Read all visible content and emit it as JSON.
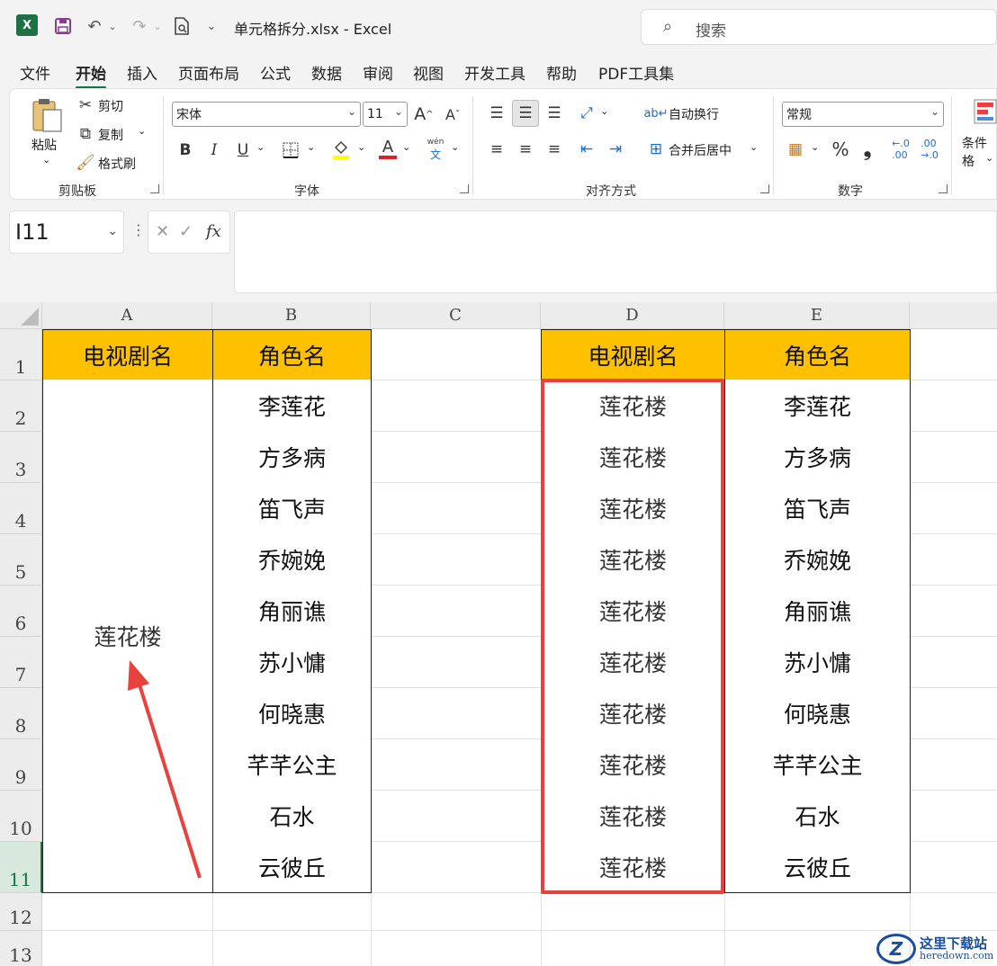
{
  "titlebar": {
    "app_icon": "X",
    "doc_title": "单元格拆分.xlsx  -  Excel",
    "search_placeholder": "搜索"
  },
  "menu": [
    "文件",
    "开始",
    "插入",
    "页面布局",
    "公式",
    "数据",
    "审阅",
    "视图",
    "开发工具",
    "帮助",
    "PDF工具集"
  ],
  "active_menu": "开始",
  "ribbon": {
    "clipboard": {
      "paste": "粘贴",
      "cut": "剪切",
      "copy": "复制",
      "format_painter": "格式刷",
      "label": "剪贴板"
    },
    "font": {
      "name": "宋体",
      "size": "11",
      "bold": "B",
      "italic": "I",
      "underline": "U",
      "font_color_glyph": "A",
      "phonetic": "wén",
      "label": "字体"
    },
    "align": {
      "wrap": "自动换行",
      "merge": "合并后居中",
      "label": "对齐方式"
    },
    "number": {
      "format": "常规",
      "percent": "%",
      "comma": "❟",
      "label": "数字"
    },
    "styles": {
      "cond_format": "条件格"
    }
  },
  "formula_bar": {
    "name_box": "I11",
    "fx": "fx",
    "value": ""
  },
  "columns": [
    "A",
    "B",
    "C",
    "D",
    "E"
  ],
  "rows": [
    "1",
    "2",
    "3",
    "4",
    "5",
    "6",
    "7",
    "8",
    "9",
    "10",
    "11",
    "12",
    "13"
  ],
  "selected_row": "11",
  "table_left": {
    "header_a": "电视剧名",
    "header_b": "角色名",
    "merged_value": "莲花楼",
    "roles": [
      "李莲花",
      "方多病",
      "笛飞声",
      "乔婉娩",
      "角丽谯",
      "苏小慵",
      "何晓惠",
      "芊芊公主",
      "石水",
      "云彼丘"
    ]
  },
  "table_right": {
    "header_d": "电视剧名",
    "header_e": "角色名",
    "drama": [
      "莲花楼",
      "莲花楼",
      "莲花楼",
      "莲花楼",
      "莲花楼",
      "莲花楼",
      "莲花楼",
      "莲花楼",
      "莲花楼",
      "莲花楼"
    ],
    "roles": [
      "李莲花",
      "方多病",
      "笛飞声",
      "乔婉娩",
      "角丽谯",
      "苏小慵",
      "何晓惠",
      "芊芊公主",
      "石水",
      "云彼丘"
    ]
  },
  "colors": {
    "header_fill": "#ffc000",
    "highlight": "#e8413e",
    "excel_green": "#1e7145"
  },
  "watermark": {
    "logo": "Z",
    "text": "这里下载站",
    "url": "heredown.com"
  }
}
